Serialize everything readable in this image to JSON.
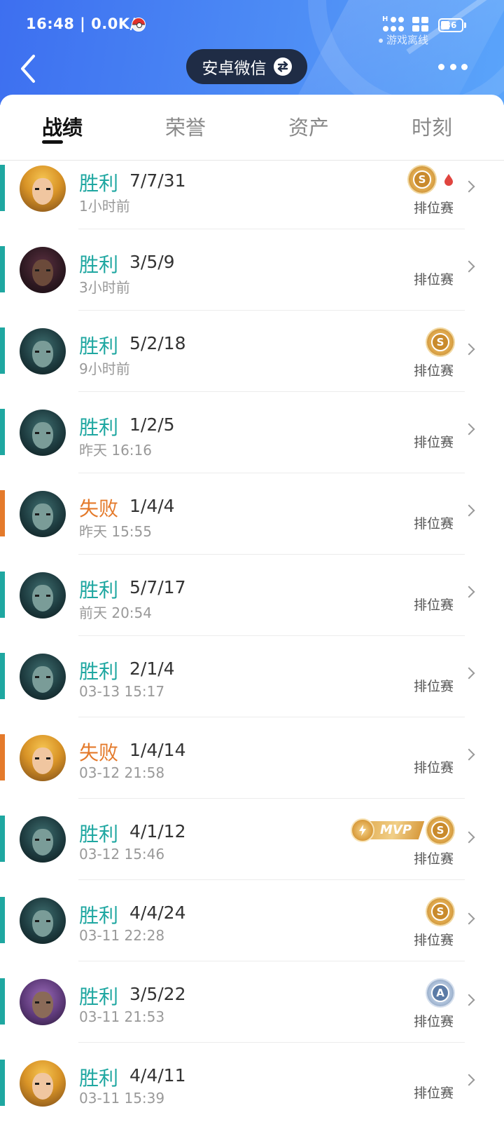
{
  "status_bar": {
    "time": "16:48 | 0.0K/s",
    "battery": "36",
    "signal_tag": "H",
    "game_status": "游戏离线"
  },
  "header": {
    "account_name": "安卓微信",
    "back_icon": "chevron-left-icon",
    "switch_icon": "swap-arrows-icon",
    "more_icon": "more-dots-icon"
  },
  "tabs": [
    {
      "label": "战绩",
      "active": true
    },
    {
      "label": "荣誉",
      "active": false
    },
    {
      "label": "资产",
      "active": false
    },
    {
      "label": "时刻",
      "active": false
    }
  ],
  "colors": {
    "win": "#1fa7a1",
    "loss": "#e47a2b",
    "header_blue": "#4d8cf5",
    "account_pill": "#1f2c45"
  },
  "matches": [
    {
      "result": "胜利",
      "outcome": "win",
      "kda": "7/7/31",
      "time": "1小时前",
      "mode": "排位赛",
      "avatar": "blonde",
      "badges": [
        "s-medal",
        "blood-drop"
      ]
    },
    {
      "result": "胜利",
      "outcome": "win",
      "kda": "3/5/9",
      "time": "3小时前",
      "mode": "排位赛",
      "avatar": "dark",
      "badges": []
    },
    {
      "result": "胜利",
      "outcome": "win",
      "kda": "5/2/18",
      "time": "9小时前",
      "mode": "排位赛",
      "avatar": "teal",
      "badges": [
        "s-medal"
      ]
    },
    {
      "result": "胜利",
      "outcome": "win",
      "kda": "1/2/5",
      "time": "昨天 16:16",
      "mode": "排位赛",
      "avatar": "teal",
      "badges": []
    },
    {
      "result": "失败",
      "outcome": "loss",
      "kda": "1/4/4",
      "time": "昨天 15:55",
      "mode": "排位赛",
      "avatar": "teal",
      "badges": []
    },
    {
      "result": "胜利",
      "outcome": "win",
      "kda": "5/7/17",
      "time": "前天 20:54",
      "mode": "排位赛",
      "avatar": "teal",
      "badges": []
    },
    {
      "result": "胜利",
      "outcome": "win",
      "kda": "2/1/4",
      "time": "03-13 15:17",
      "mode": "排位赛",
      "avatar": "teal",
      "badges": []
    },
    {
      "result": "失败",
      "outcome": "loss",
      "kda": "1/4/14",
      "time": "03-12 21:58",
      "mode": "排位赛",
      "avatar": "blonde",
      "badges": []
    },
    {
      "result": "胜利",
      "outcome": "win",
      "kda": "4/1/12",
      "time": "03-12 15:46",
      "mode": "排位赛",
      "avatar": "teal",
      "badges": [
        "mvp",
        "s-medal"
      ]
    },
    {
      "result": "胜利",
      "outcome": "win",
      "kda": "4/4/24",
      "time": "03-11 22:28",
      "mode": "排位赛",
      "avatar": "teal",
      "badges": [
        "s-medal"
      ]
    },
    {
      "result": "胜利",
      "outcome": "win",
      "kda": "3/5/22",
      "time": "03-11 21:53",
      "mode": "排位赛",
      "avatar": "purple",
      "badges": [
        "a-medal"
      ]
    },
    {
      "result": "胜利",
      "outcome": "win",
      "kda": "4/4/11",
      "time": "03-11 15:39",
      "mode": "排位赛",
      "avatar": "blonde",
      "badges": []
    }
  ],
  "badge_text": {
    "s_medal": "S",
    "a_medal": "A",
    "mvp": "MVP"
  }
}
